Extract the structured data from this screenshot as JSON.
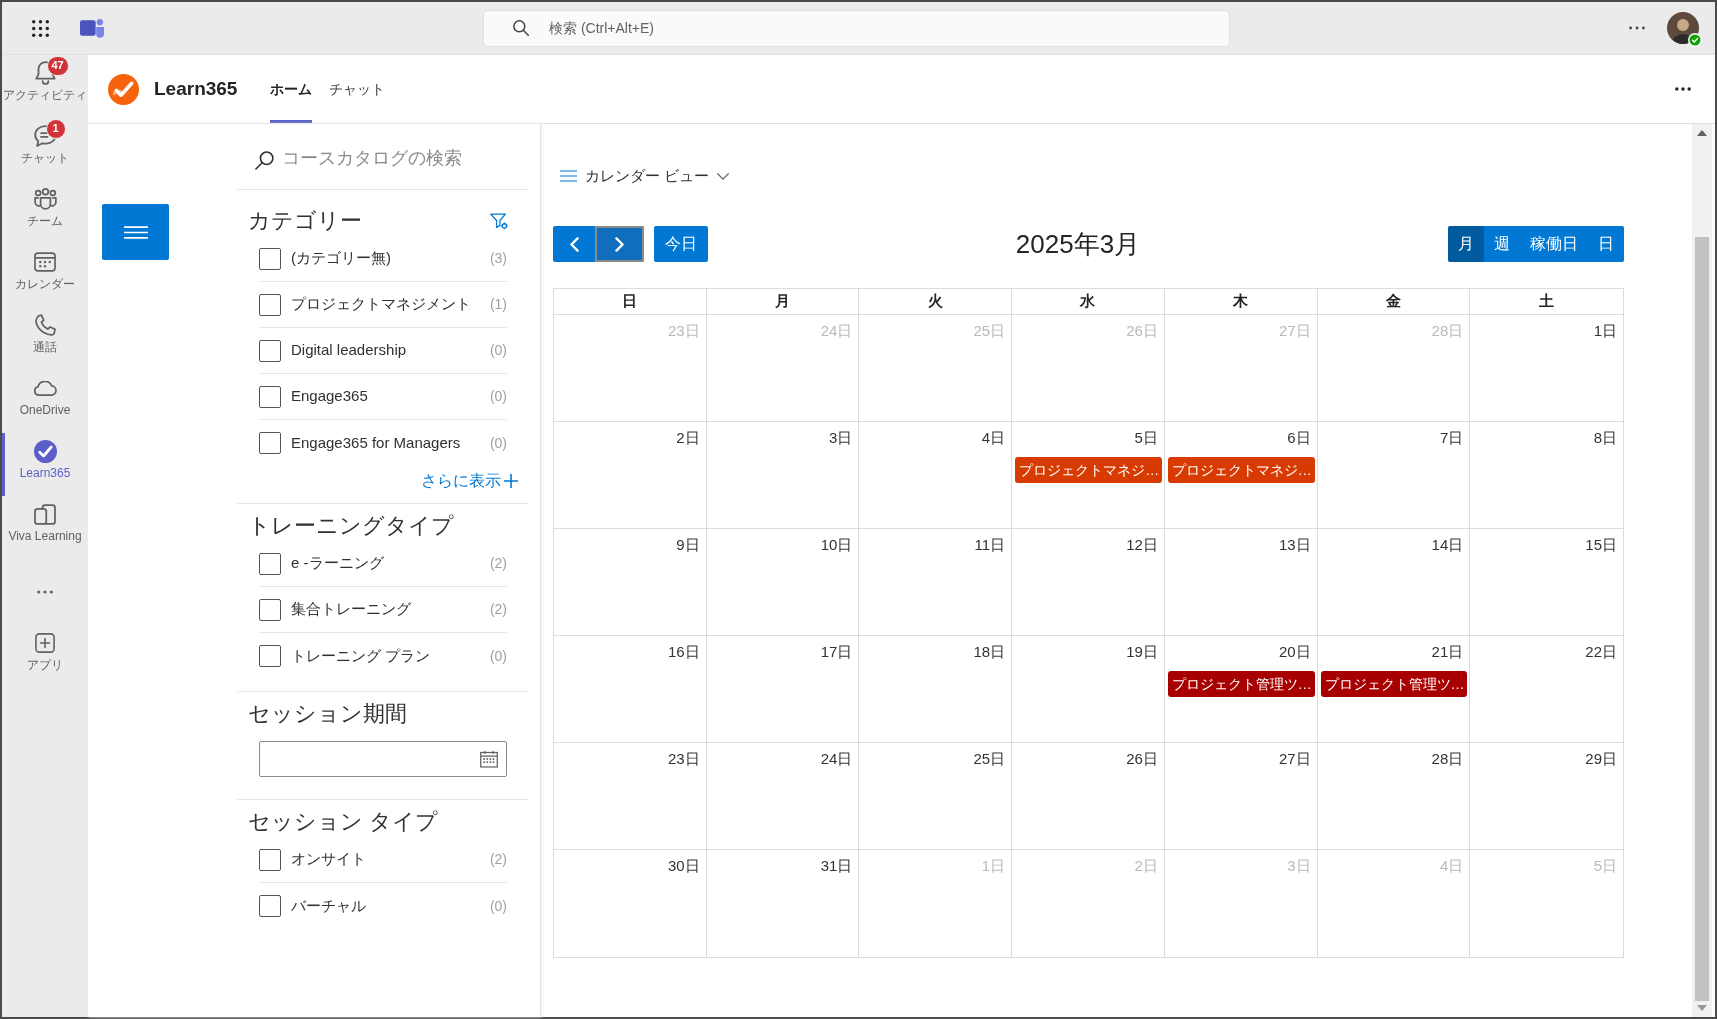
{
  "top_bar": {
    "search": {
      "placeholder": "検索 (Ctrl+Alt+E)"
    }
  },
  "rail": {
    "items": [
      {
        "label": "アクティビティ",
        "badge": "47",
        "selected": false
      },
      {
        "label": "チャット",
        "badge": "1",
        "selected": false
      },
      {
        "label": "チーム",
        "selected": false
      },
      {
        "label": "カレンダー",
        "selected": false
      },
      {
        "label": "通話",
        "selected": false
      },
      {
        "label": "OneDrive",
        "selected": false
      },
      {
        "label": "Learn365",
        "selected": true
      },
      {
        "label": "Viva Learning",
        "selected": false
      }
    ],
    "apps": {
      "label": "アプリ"
    }
  },
  "app_header": {
    "title": "Learn365",
    "tabs": [
      {
        "label": "ホーム",
        "selected": true
      },
      {
        "label": "チャット",
        "selected": false
      }
    ]
  },
  "filters": {
    "search": {
      "placeholder": "コースカタログの検索"
    },
    "sections": [
      {
        "kind": "checklist",
        "title": "カテゴリー",
        "items": [
          {
            "label": "(カテゴリー無)",
            "count": "(3)",
            "checked": false
          },
          {
            "label": "プロジェクトマネジメント",
            "count": "(1)",
            "checked": false
          },
          {
            "label": "Digital leadership",
            "count": "(0)",
            "checked": false
          },
          {
            "label": "Engage365",
            "count": "(0)",
            "checked": false
          },
          {
            "label": "Engage365 for Managers",
            "count": "(0)",
            "checked": false
          }
        ],
        "more_link": "さらに表示"
      },
      {
        "kind": "checklist",
        "title": "トレーニングタイプ",
        "items": [
          {
            "label": "e -ラーニング",
            "count": "(2)",
            "checked": false
          },
          {
            "label": "集合トレーニング",
            "count": "(2)",
            "checked": false
          },
          {
            "label": "トレーニング プラン",
            "count": "(0)",
            "checked": false
          }
        ]
      },
      {
        "kind": "date_range",
        "title": "セッション期間"
      },
      {
        "kind": "checklist",
        "title": "セッション タイプ",
        "items": [
          {
            "label": "オンサイト",
            "count": "(2)",
            "checked": false
          },
          {
            "label": "バーチャル",
            "count": "(0)",
            "checked": false
          }
        ]
      }
    ]
  },
  "calendar": {
    "view_menu": "カレンダー ビュー",
    "nav_buttons": [
      {
        "kind": "prev",
        "focused": false
      },
      {
        "kind": "next",
        "focused": true
      }
    ],
    "today_button": "今日",
    "title": "2025年3月",
    "views": [
      {
        "label": "月",
        "selected": true
      },
      {
        "label": "週",
        "selected": false
      },
      {
        "label": "稼働日",
        "selected": false
      },
      {
        "label": "日",
        "selected": false
      }
    ],
    "weekdays": [
      "日",
      "月",
      "火",
      "水",
      "木",
      "金",
      "土"
    ],
    "weeks": [
      {
        "days": [
          {
            "label": "23日",
            "in_month": false
          },
          {
            "label": "24日",
            "in_month": false
          },
          {
            "label": "25日",
            "in_month": false
          },
          {
            "label": "26日",
            "in_month": false
          },
          {
            "label": "27日",
            "in_month": false
          },
          {
            "label": "28日",
            "in_month": false
          },
          {
            "label": "1日",
            "in_month": true
          }
        ]
      },
      {
        "days": [
          {
            "label": "2日",
            "in_month": true
          },
          {
            "label": "3日",
            "in_month": true
          },
          {
            "label": "4日",
            "in_month": true
          },
          {
            "label": "5日",
            "in_month": true,
            "events": [
              {
                "title": "プロジェクトマネジ…",
                "color": "#d83b01"
              }
            ]
          },
          {
            "label": "6日",
            "in_month": true,
            "events": [
              {
                "title": "プロジェクトマネジ…",
                "color": "#d83b01"
              }
            ]
          },
          {
            "label": "7日",
            "in_month": true
          },
          {
            "label": "8日",
            "in_month": true
          }
        ]
      },
      {
        "days": [
          {
            "label": "9日",
            "in_month": true
          },
          {
            "label": "10日",
            "in_month": true
          },
          {
            "label": "11日",
            "in_month": true
          },
          {
            "label": "12日",
            "in_month": true
          },
          {
            "label": "13日",
            "in_month": true
          },
          {
            "label": "14日",
            "in_month": true
          },
          {
            "label": "15日",
            "in_month": true
          }
        ]
      },
      {
        "days": [
          {
            "label": "16日",
            "in_month": true
          },
          {
            "label": "17日",
            "in_month": true
          },
          {
            "label": "18日",
            "in_month": true
          },
          {
            "label": "19日",
            "in_month": true
          },
          {
            "label": "20日",
            "in_month": true,
            "events": [
              {
                "title": "プロジェクト管理ツ…",
                "color": "#a80000"
              }
            ]
          },
          {
            "label": "21日",
            "in_month": true,
            "events": [
              {
                "title": "プロジェクト管理ツ…",
                "color": "#a80000"
              }
            ]
          },
          {
            "label": "22日",
            "in_month": true
          }
        ]
      },
      {
        "days": [
          {
            "label": "23日",
            "in_month": true
          },
          {
            "label": "24日",
            "in_month": true
          },
          {
            "label": "25日",
            "in_month": true
          },
          {
            "label": "26日",
            "in_month": true
          },
          {
            "label": "27日",
            "in_month": true
          },
          {
            "label": "28日",
            "in_month": true
          },
          {
            "label": "29日",
            "in_month": true
          }
        ]
      },
      {
        "days": [
          {
            "label": "30日",
            "in_month": true
          },
          {
            "label": "31日",
            "in_month": true
          },
          {
            "label": "1日",
            "in_month": false
          },
          {
            "label": "2日",
            "in_month": false
          },
          {
            "label": "3日",
            "in_month": false
          },
          {
            "label": "4日",
            "in_month": false
          },
          {
            "label": "5日",
            "in_month": false
          }
        ]
      }
    ]
  }
}
